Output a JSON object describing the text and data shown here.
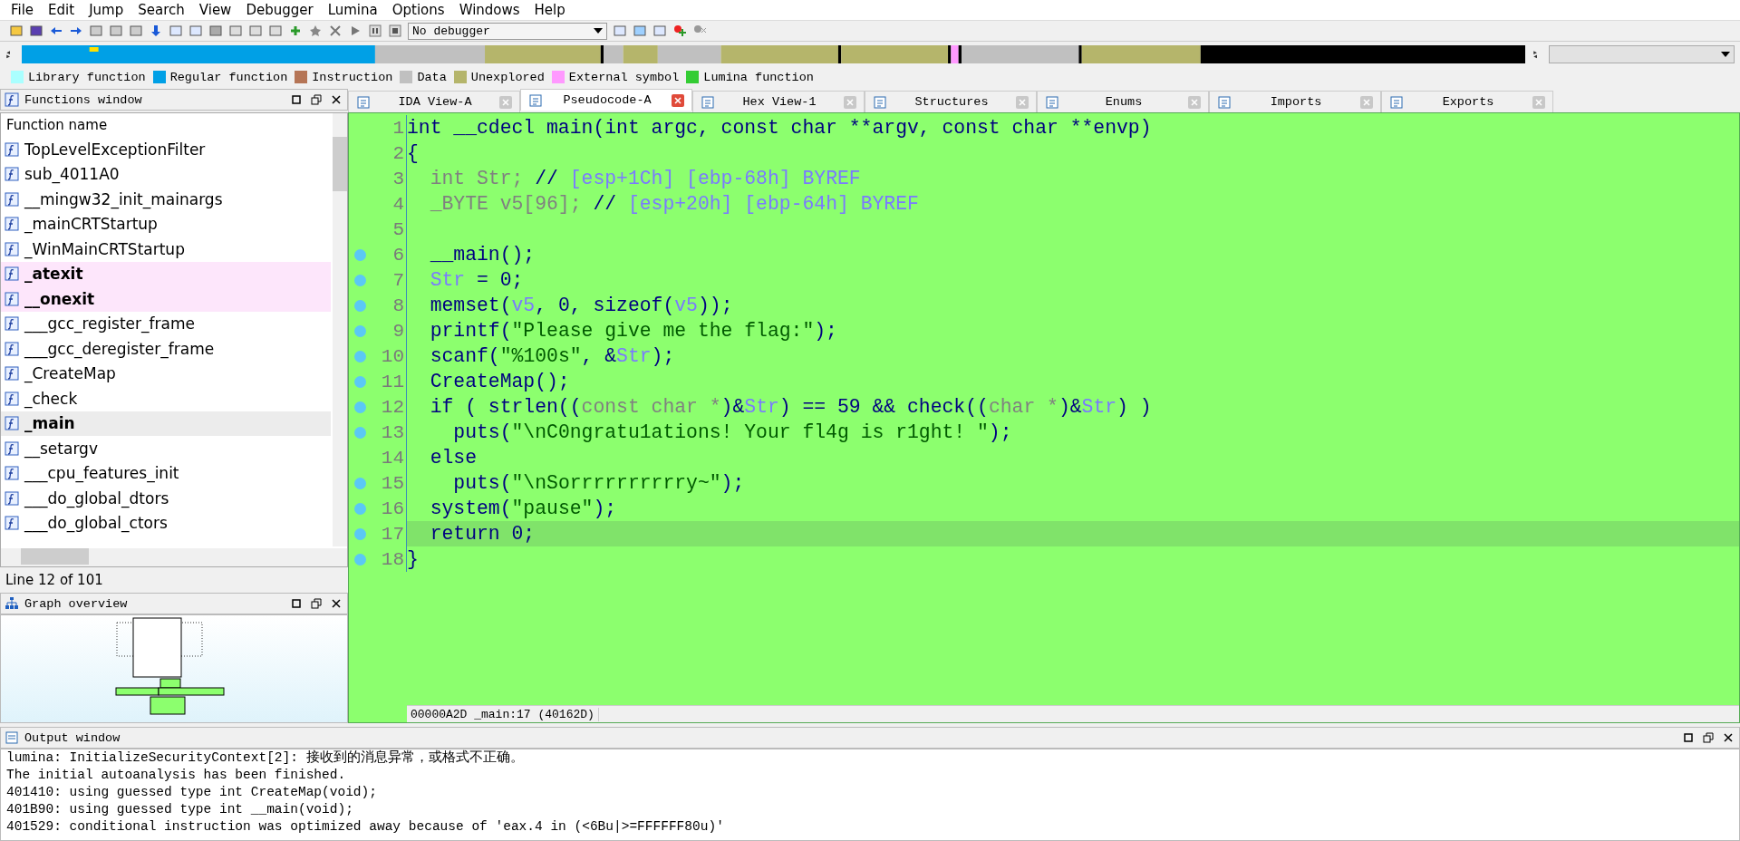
{
  "menu": [
    "File",
    "Edit",
    "Jump",
    "Search",
    "View",
    "Debugger",
    "Lumina",
    "Options",
    "Windows",
    "Help"
  ],
  "toolbar": {
    "debugger_select": "No debugger"
  },
  "legend": [
    {
      "label": "Library function",
      "color": "#aaffff"
    },
    {
      "label": "Regular function",
      "color": "#00a0e6"
    },
    {
      "label": "Instruction",
      "color": "#b57556"
    },
    {
      "label": "Data",
      "color": "#c0c0c0"
    },
    {
      "label": "Unexplored",
      "color": "#b5b56b"
    },
    {
      "label": "External symbol",
      "color": "#ff99ff"
    },
    {
      "label": "Lumina function",
      "color": "#33cc33"
    }
  ],
  "functions_window": {
    "title": "Functions window",
    "column": "Function name",
    "rows": [
      {
        "name": "TopLevelExceptionFilter",
        "external": false,
        "selected": false
      },
      {
        "name": "sub_4011A0",
        "external": false,
        "selected": false
      },
      {
        "name": "__mingw32_init_mainargs",
        "external": false,
        "selected": false
      },
      {
        "name": "_mainCRTStartup",
        "external": false,
        "selected": false
      },
      {
        "name": "_WinMainCRTStartup",
        "external": false,
        "selected": false
      },
      {
        "name": "_atexit",
        "external": true,
        "selected": false
      },
      {
        "name": "__onexit",
        "external": true,
        "selected": false
      },
      {
        "name": "___gcc_register_frame",
        "external": false,
        "selected": false
      },
      {
        "name": "___gcc_deregister_frame",
        "external": false,
        "selected": false
      },
      {
        "name": "_CreateMap",
        "external": false,
        "selected": false
      },
      {
        "name": "_check",
        "external": false,
        "selected": false
      },
      {
        "name": "_main",
        "external": false,
        "selected": true
      },
      {
        "name": "__setargv",
        "external": false,
        "selected": false
      },
      {
        "name": "___cpu_features_init",
        "external": false,
        "selected": false
      },
      {
        "name": "___do_global_dtors",
        "external": false,
        "selected": false
      },
      {
        "name": "___do_global_ctors",
        "external": false,
        "selected": false
      }
    ],
    "status": "Line 12 of 101"
  },
  "graph_overview": {
    "title": "Graph overview"
  },
  "tabs": [
    {
      "label": "IDA View-A",
      "selected": false
    },
    {
      "label": "Pseudocode-A",
      "selected": true
    },
    {
      "label": "Hex View-1",
      "selected": false
    },
    {
      "label": "Structures",
      "selected": false
    },
    {
      "label": "Enums",
      "selected": false
    },
    {
      "label": "Imports",
      "selected": false
    },
    {
      "label": "Exports",
      "selected": false
    }
  ],
  "code": {
    "lines": [
      {
        "number": "1",
        "breakpoint": false,
        "current": false,
        "tokens": [
          {
            "kind": "p",
            "text": "int __cdecl main(int argc, const char **argv, const char **envp)"
          }
        ]
      },
      {
        "number": "2",
        "breakpoint": false,
        "current": false,
        "tokens": [
          {
            "kind": "p",
            "text": "{"
          }
        ]
      },
      {
        "number": "3",
        "breakpoint": false,
        "current": false,
        "tokens": [
          {
            "kind": "g",
            "text": "  int Str;"
          },
          {
            "kind": "p",
            "text": " // "
          },
          {
            "kind": "c",
            "text": "[esp+1Ch] [ebp-68h] BYREF"
          }
        ]
      },
      {
        "number": "4",
        "breakpoint": false,
        "current": false,
        "tokens": [
          {
            "kind": "g",
            "text": "  _BYTE v5[96];"
          },
          {
            "kind": "p",
            "text": " // "
          },
          {
            "kind": "c",
            "text": "[esp+20h] [ebp-64h] BYREF"
          }
        ]
      },
      {
        "number": "5",
        "breakpoint": false,
        "current": false
      },
      {
        "number": "6",
        "breakpoint": true,
        "current": false,
        "tokens": [
          {
            "kind": "p",
            "text": "  __main();"
          }
        ]
      },
      {
        "number": "7",
        "breakpoint": true,
        "current": false,
        "tokens": [
          {
            "kind": "v",
            "text": "  Str"
          },
          {
            "kind": "p",
            "text": " = 0;"
          }
        ]
      },
      {
        "number": "8",
        "breakpoint": true,
        "current": false,
        "tokens": [
          {
            "kind": "p",
            "text": "  memset("
          },
          {
            "kind": "v",
            "text": "v5"
          },
          {
            "kind": "p",
            "text": ", 0, sizeof("
          },
          {
            "kind": "v",
            "text": "v5"
          },
          {
            "kind": "p",
            "text": "));"
          }
        ]
      },
      {
        "number": "9",
        "breakpoint": true,
        "current": false,
        "tokens": [
          {
            "kind": "p",
            "text": "  printf("
          },
          {
            "kind": "s",
            "text": "\"Please give me the flag:\""
          },
          {
            "kind": "p",
            "text": ");"
          }
        ]
      },
      {
        "number": "10",
        "breakpoint": true,
        "current": false,
        "tokens": [
          {
            "kind": "p",
            "text": "  scanf("
          },
          {
            "kind": "s",
            "text": "\"%100s\""
          },
          {
            "kind": "p",
            "text": ", &"
          },
          {
            "kind": "v",
            "text": "Str"
          },
          {
            "kind": "p",
            "text": ");"
          }
        ]
      },
      {
        "number": "11",
        "breakpoint": true,
        "current": false,
        "tokens": [
          {
            "kind": "p",
            "text": "  CreateMap();"
          }
        ]
      },
      {
        "number": "12",
        "breakpoint": true,
        "current": false,
        "tokens": [
          {
            "kind": "p",
            "text": "  if ( strlen(("
          },
          {
            "kind": "g",
            "text": "const char *"
          },
          {
            "kind": "p",
            "text": ")&"
          },
          {
            "kind": "v",
            "text": "Str"
          },
          {
            "kind": "p",
            "text": ") == 59 && check(("
          },
          {
            "kind": "g",
            "text": "char *"
          },
          {
            "kind": "p",
            "text": ")&"
          },
          {
            "kind": "v",
            "text": "Str"
          },
          {
            "kind": "p",
            "text": ") )"
          }
        ]
      },
      {
        "number": "13",
        "breakpoint": true,
        "current": false,
        "tokens": [
          {
            "kind": "p",
            "text": "    puts("
          },
          {
            "kind": "s",
            "text": "\"\\nC0ngratu1ations! Your fl4g is r1ght! \""
          },
          {
            "kind": "p",
            "text": ");"
          }
        ]
      },
      {
        "number": "14",
        "breakpoint": false,
        "current": false,
        "tokens": [
          {
            "kind": "p",
            "text": "  else"
          }
        ]
      },
      {
        "number": "15",
        "breakpoint": true,
        "current": false,
        "tokens": [
          {
            "kind": "p",
            "text": "    puts("
          },
          {
            "kind": "s",
            "text": "\"\\nSorrrrrrrrrry~\""
          },
          {
            "kind": "p",
            "text": ");"
          }
        ]
      },
      {
        "number": "16",
        "breakpoint": true,
        "current": false,
        "tokens": [
          {
            "kind": "p",
            "text": "  system("
          },
          {
            "kind": "s",
            "text": "\"pause\""
          },
          {
            "kind": "p",
            "text": ");"
          }
        ]
      },
      {
        "number": "17",
        "breakpoint": true,
        "current": true,
        "tokens": [
          {
            "kind": "p",
            "text": "  return 0;"
          }
        ]
      },
      {
        "number": "18",
        "breakpoint": true,
        "current": false,
        "tokens": [
          {
            "kind": "p",
            "text": "}"
          }
        ]
      }
    ],
    "status": "00000A2D _main:17 (40162D)"
  },
  "output_window": {
    "title": "Output window",
    "lines": [
      "lumina: InitializeSecurityContext[2]: 接收到的消息异常，或格式不正确。",
      "The initial autoanalysis has been finished.",
      "401410: using guessed type int CreateMap(void);",
      "401B90: using guessed type int __main(void);",
      "401529: conditional instruction was optimized away because of 'eax.4 in (<6Bu|>=FFFFFF80u)'"
    ]
  }
}
